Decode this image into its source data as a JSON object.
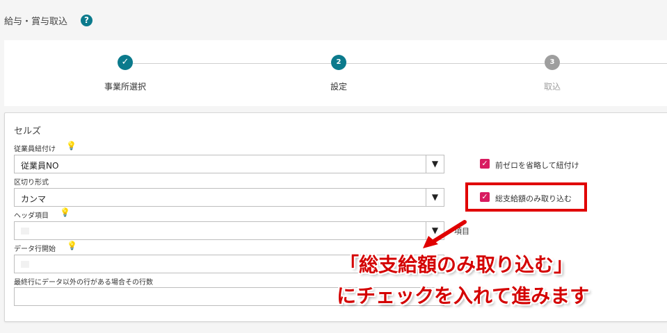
{
  "page": {
    "title": "給与・賞与取込",
    "help": "?"
  },
  "stepper": {
    "steps": [
      {
        "label": "事業所選択",
        "marker": "✓",
        "state": "done"
      },
      {
        "label": "設定",
        "marker": "2",
        "state": "active"
      },
      {
        "label": "取込",
        "marker": "3",
        "state": "pending"
      }
    ]
  },
  "form": {
    "section_title": "セルズ",
    "employee_link": {
      "label": "従業員紐付け",
      "value": "従業員NO"
    },
    "delimiter": {
      "label": "区切り形式",
      "value": "カンマ"
    },
    "header_item": {
      "label": "ヘッダ項目",
      "value": "",
      "trailing_text": "項目"
    },
    "data_start": {
      "label": "データ行開始",
      "value": ""
    },
    "last_rows": {
      "label": "最終行にデータ以外の行がある場合その行数",
      "value": ""
    },
    "dropdown_arrow": "▼",
    "options": [
      {
        "label": "前ゼロを省略して紐付け",
        "checked": true
      },
      {
        "label": "総支給額のみ取り込む",
        "checked": true
      }
    ]
  },
  "annotation": {
    "line1": "「総支給額のみ取り込む」",
    "line2": "にチェックを入れて進みます",
    "color": "#d40000"
  },
  "colors": {
    "primary": "#0b7a8c",
    "checkbox": "#d81b60",
    "pending": "#9e9e9e"
  }
}
